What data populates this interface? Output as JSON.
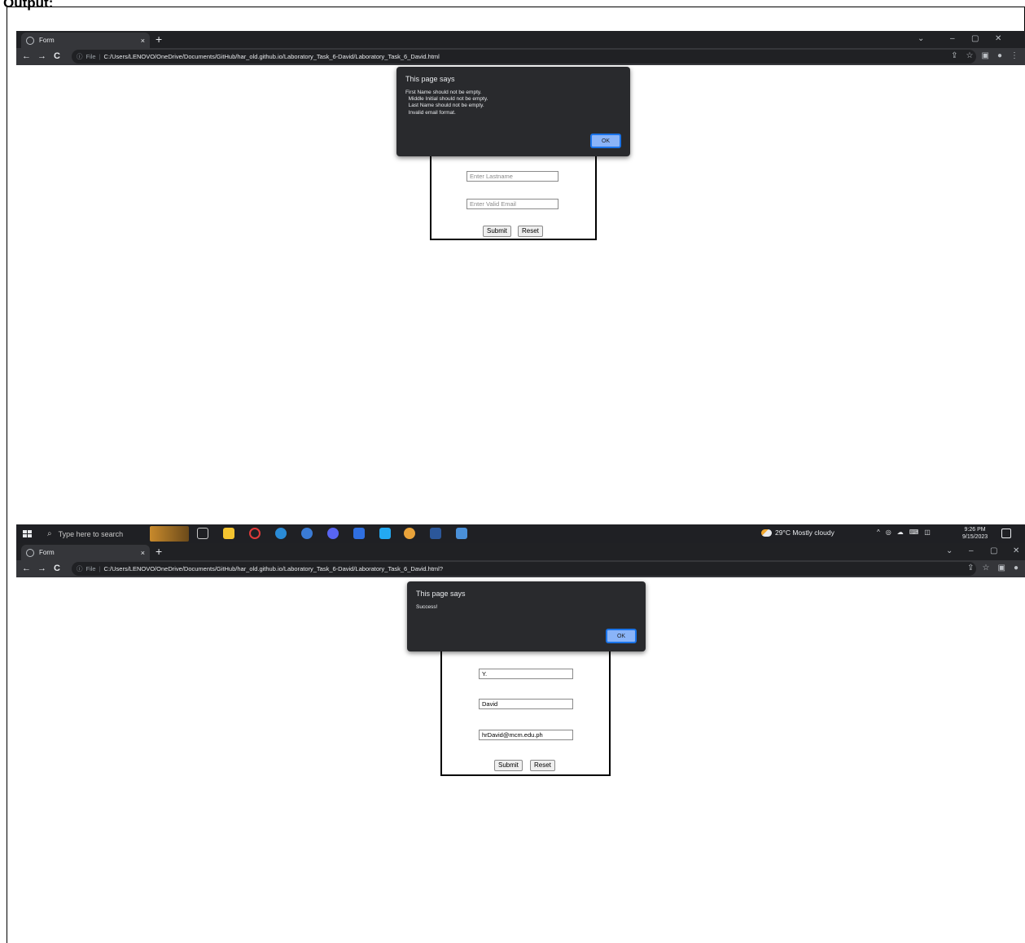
{
  "document": {
    "heading": "Output:"
  },
  "screenshot1": {
    "tab": {
      "title": "Form",
      "close": "×"
    },
    "new_tab": "+",
    "window_controls": [
      "⌄",
      "–",
      "▢",
      "✕"
    ],
    "nav": {
      "back": "←",
      "forward": "→",
      "reload": "C"
    },
    "address": {
      "info": "ⓘ",
      "chip": "File",
      "separator": "|",
      "url": "C:/Users/LENOVO/OneDrive/Documents/GitHub/har_old.github.io/Laboratory_Task_6-David/Laboratory_Task_6_David.html"
    },
    "toolbar_icons": [
      "⇪",
      "☆",
      "▣",
      "●",
      "⋮"
    ],
    "dialog": {
      "title": "This page says",
      "message": "First Name should not be empty.\n  Middle Initial should not be empty.\n  Last Name should not be empty.\n  Invalid email format.",
      "ok": "OK"
    },
    "form": {
      "lastname_placeholder": "Enter Lastname",
      "email_placeholder": "Enter Valid Email",
      "submit": "Submit",
      "reset": "Reset"
    },
    "taskbar": {
      "search_icon": "⌕",
      "search_placeholder": "Type here to search",
      "weather": "29°C  Mostly cloudy",
      "tray": [
        "^",
        "◎",
        "☁",
        "⌨",
        "◫"
      ],
      "time": "9:26 PM",
      "date": "9/15/2023"
    }
  },
  "screenshot2": {
    "tab": {
      "title": "Form",
      "close": "×"
    },
    "new_tab": "+",
    "window_controls": [
      "⌄",
      "–",
      "▢",
      "✕"
    ],
    "nav": {
      "back": "←",
      "forward": "→",
      "reload": "C"
    },
    "address": {
      "info": "ⓘ",
      "chip": "File",
      "separator": "|",
      "url": "C:/Users/LENOVO/OneDrive/Documents/GitHub/har_old.github.io/Laboratory_Task_6-David/Laboratory_Task_6_David.html?"
    },
    "toolbar_icons": [
      "⇪",
      "☆",
      "▣",
      "●"
    ],
    "dialog": {
      "title": "This page says",
      "message": "Success!",
      "ok": "OK"
    },
    "form": {
      "middle_initial": "Y.",
      "lastname": "David",
      "email": "hrDavid@mcm.edu.ph",
      "submit": "Submit",
      "reset": "Reset"
    }
  },
  "colors": {
    "chrome_dark": "#202124",
    "chrome_toolbar": "#35363a",
    "dialog_bg": "#292a2d",
    "ok_button": "#8ab4f8",
    "taskbar": "#1f2024"
  }
}
